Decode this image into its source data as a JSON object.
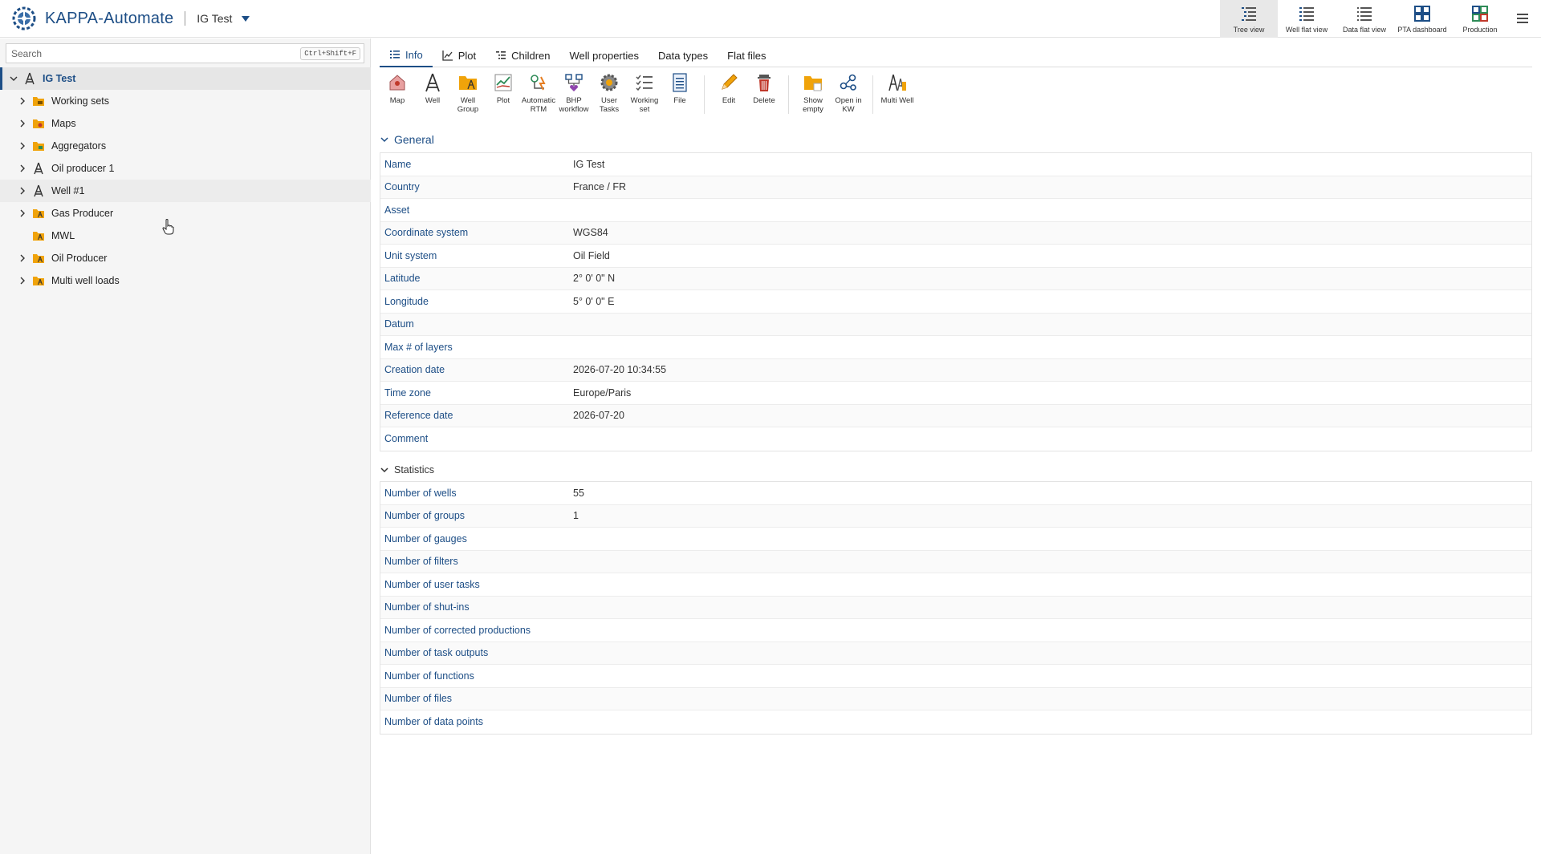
{
  "header": {
    "app_title": "KAPPA-Automate",
    "project_name": "IG Test",
    "views": [
      {
        "label": "Tree view",
        "icon": "tree-view-icon",
        "active": true
      },
      {
        "label": "Well flat view",
        "icon": "well-flat-view-icon",
        "active": false
      },
      {
        "label": "Data flat view",
        "icon": "data-flat-view-icon",
        "active": false
      },
      {
        "label": "PTA dashboard",
        "icon": "pta-dashboard-icon",
        "active": false
      },
      {
        "label": "Production",
        "icon": "production-icon",
        "active": false
      }
    ]
  },
  "sidebar": {
    "search_placeholder": "Search",
    "search_shortcut": "Ctrl+Shift+F",
    "items": [
      {
        "label": "IG Test",
        "icon": "well-icon"
      },
      {
        "label": "Working sets",
        "icon": "folder-icon"
      },
      {
        "label": "Maps",
        "icon": "folder-icon"
      },
      {
        "label": "Aggregators",
        "icon": "folder-icon"
      },
      {
        "label": "Oil producer 1",
        "icon": "well-icon"
      },
      {
        "label": "Well #1",
        "icon": "well-icon"
      },
      {
        "label": "Gas Producer",
        "icon": "well-group-icon"
      },
      {
        "label": "MWL",
        "icon": "well-group-icon"
      },
      {
        "label": "Oil Producer",
        "icon": "well-group-icon"
      },
      {
        "label": "Multi well loads",
        "icon": "well-group-icon"
      }
    ]
  },
  "tabs": [
    "Info",
    "Plot",
    "Children",
    "Well properties",
    "Data types",
    "Flat files"
  ],
  "toolbar": {
    "tools": [
      {
        "label": "Map",
        "icon": "map-icon"
      },
      {
        "label": "Well",
        "icon": "well-icon"
      },
      {
        "label": "Well Group",
        "icon": "well-group-icon"
      },
      {
        "label": "Plot",
        "icon": "plot-icon"
      },
      {
        "label": "Automatic RTM",
        "icon": "automatic-rtm-icon"
      },
      {
        "label": "BHP workflow",
        "icon": "bhp-workflow-icon"
      },
      {
        "label": "User Tasks",
        "icon": "user-tasks-icon"
      },
      {
        "label": "Working set",
        "icon": "working-set-icon"
      },
      {
        "label": "File",
        "icon": "file-icon"
      },
      {
        "label": "Edit",
        "icon": "edit-icon"
      },
      {
        "label": "Delete",
        "icon": "delete-icon"
      },
      {
        "label": "Show empty",
        "icon": "show-empty-icon"
      },
      {
        "label": "Open in KW",
        "icon": "open-in-kw-icon"
      },
      {
        "label": "Multi Well",
        "icon": "multi-well-icon"
      }
    ]
  },
  "general": {
    "title": "General",
    "rows": [
      {
        "key": "Name",
        "value": "IG Test"
      },
      {
        "key": "Country",
        "value": "France / FR"
      },
      {
        "key": "Asset",
        "value": ""
      },
      {
        "key": "Coordinate system",
        "value": "WGS84"
      },
      {
        "key": "Unit system",
        "value": "Oil Field"
      },
      {
        "key": "Latitude",
        "value": "2° 0' 0\" N"
      },
      {
        "key": "Longitude",
        "value": "5° 0' 0\" E"
      },
      {
        "key": "Datum",
        "value": ""
      },
      {
        "key": "Max # of layers",
        "value": ""
      },
      {
        "key": "Creation date",
        "value": "2026-07-20 10:34:55"
      },
      {
        "key": "Time zone",
        "value": "Europe/Paris"
      },
      {
        "key": "Reference date",
        "value": "2026-07-20"
      },
      {
        "key": "Comment",
        "value": ""
      }
    ]
  },
  "statistics": {
    "title": "Statistics",
    "rows": [
      {
        "key": "Number of wells",
        "value": "55"
      },
      {
        "key": "Number of groups",
        "value": "1"
      },
      {
        "key": "Number of gauges",
        "value": ""
      },
      {
        "key": "Number of filters",
        "value": ""
      },
      {
        "key": "Number of user tasks",
        "value": ""
      },
      {
        "key": "Number of shut-ins",
        "value": ""
      },
      {
        "key": "Number of corrected productions",
        "value": ""
      },
      {
        "key": "Number of task outputs",
        "value": ""
      },
      {
        "key": "Number of functions",
        "value": ""
      },
      {
        "key": "Number of files",
        "value": ""
      },
      {
        "key": "Number of data points",
        "value": ""
      }
    ]
  },
  "colors": {
    "brand": "#1d4e86",
    "folder": "#f0a30a"
  }
}
